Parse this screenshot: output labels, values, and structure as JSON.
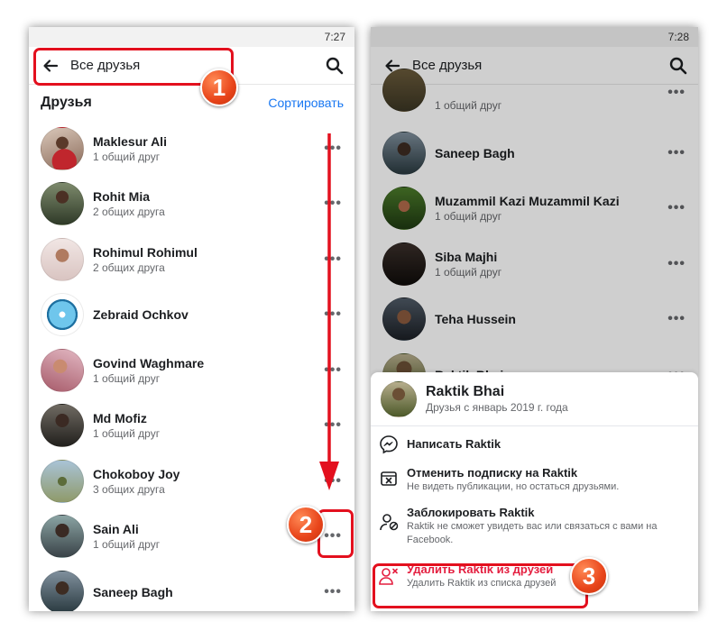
{
  "left": {
    "time": "7:27",
    "title": "Все друзья",
    "section_title": "Друзья",
    "sort_label": "Сортировать",
    "friends": [
      {
        "name": "Maklesur Ali",
        "mutual": "1 общий друг"
      },
      {
        "name": "Rohit Mia",
        "mutual": "2 общих друга"
      },
      {
        "name": "Rohimul Rohimul",
        "mutual": "2 общих друга"
      },
      {
        "name": "Zebraid Ochkov",
        "mutual": ""
      },
      {
        "name": "Govind Waghmare",
        "mutual": "1 общий друг"
      },
      {
        "name": "Md Mofiz",
        "mutual": "1 общий друг"
      },
      {
        "name": "Chokoboy Joy",
        "mutual": "3 общих друга"
      },
      {
        "name": "Sain Ali",
        "mutual": "1 общий друг"
      },
      {
        "name": "Saneep Bagh",
        "mutual": ""
      }
    ]
  },
  "right": {
    "time": "7:28",
    "title": "Все друзья",
    "friends": [
      {
        "name": "",
        "mutual": "1 общий друг"
      },
      {
        "name": "Saneep Bagh",
        "mutual": ""
      },
      {
        "name": "Muzammil Kazi Muzammil Kazi",
        "mutual": "1 общий друг"
      },
      {
        "name": "Siba Majhi",
        "mutual": "1 общий друг"
      },
      {
        "name": "Teha Hussein",
        "mutual": ""
      },
      {
        "name": "Raktik Bhai",
        "mutual": ""
      }
    ],
    "sheet": {
      "name": "Raktik Bhai",
      "since": "Друзья с январь 2019 г. года",
      "message": "Написать Raktik",
      "unfollow_title": "Отменить подписку на Raktik",
      "unfollow_sub": "Не видеть публикации, но остаться друзьями.",
      "block_title": "Заблокировать Raktik",
      "block_sub_1": "Raktik не сможет увидеть вас или связаться с вами на",
      "block_sub_2": "Facebook.",
      "unfriend_title": "Удалить Raktik из друзей",
      "unfriend_sub": "Удалить Raktik из списка друзей"
    }
  },
  "annotations": {
    "badge1": "1",
    "badge2": "2",
    "badge3": "3"
  },
  "colors": {
    "accent": "#1877f2",
    "annotation_red": "#e3101e",
    "danger": "#e41e3f"
  }
}
